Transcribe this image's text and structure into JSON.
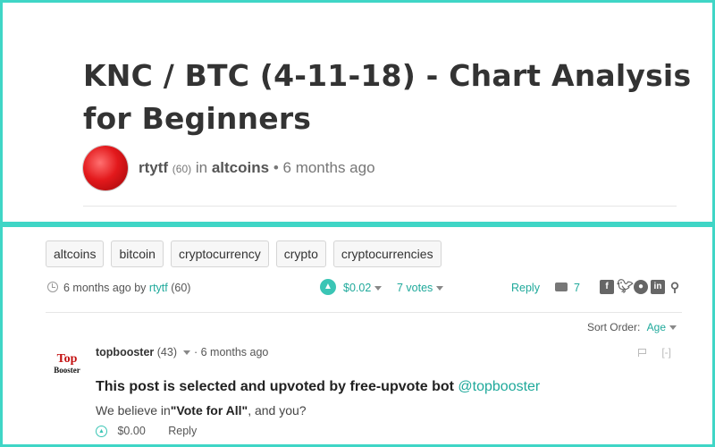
{
  "post": {
    "title": "KNC / BTC (4-11-18) - Chart Analysis for Beginners",
    "author": "rtytf",
    "reputation": "(60)",
    "in_text": "in",
    "community": "altcoins",
    "bullet": "•",
    "age": "6 months ago"
  },
  "tags": [
    "altcoins",
    "bitcoin",
    "cryptocurrency",
    "crypto",
    "cryptocurrencies"
  ],
  "meta": {
    "date_text": "6 months ago by",
    "author": "rtytf",
    "reputation": "(60)",
    "payout": "$0.02",
    "votes": "7 votes",
    "reply": "Reply",
    "comment_count": "7",
    "share_icons": [
      "facebook-icon",
      "twitter-icon",
      "reddit-icon",
      "linkedin-icon",
      "link-icon"
    ]
  },
  "sort": {
    "label": "Sort Order:",
    "value": "Age"
  },
  "comment": {
    "logo_line1": "Top",
    "logo_line2": "Booster",
    "author": "topbooster",
    "reputation": "(43)",
    "separator": "·",
    "age": "6 months ago",
    "collapse": "[-]",
    "title_text": "This post is selected and upvoted by free-upvote bot",
    "title_handle": "@topbooster",
    "body_prefix": "We believe in",
    "body_bold": "\"Vote for All\"",
    "body_suffix": ", and you?",
    "payout": "$0.00",
    "reply": "Reply"
  },
  "colors": {
    "accent": "#1fa99b",
    "frame": "#3fd6c6",
    "logo_red": "#c31111"
  }
}
